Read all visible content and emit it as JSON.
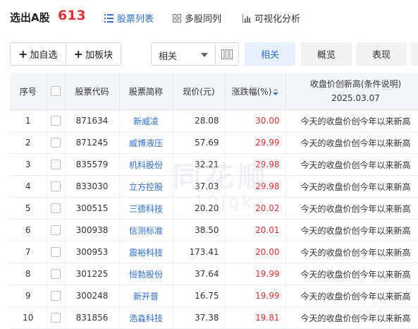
{
  "header": {
    "title": "选出A股",
    "count": "613",
    "tabs": [
      {
        "label": "股票列表",
        "icon": "list-icon"
      },
      {
        "label": "多股同列",
        "icon": "grid-icon"
      },
      {
        "label": "可视化分析",
        "icon": "bar-chart-icon"
      }
    ]
  },
  "toolbar": {
    "add_watch": "加自选",
    "add_sector": "加板块",
    "select_value": "相关",
    "segments": [
      "相关",
      "概览",
      "表现"
    ]
  },
  "table": {
    "columns": [
      "序号",
      "",
      "股票代码",
      "股票简称",
      "现价(元)",
      "涨跌幅(%)",
      "收盘价创新高(条件说明)"
    ],
    "condition_date": "2025.03.07",
    "rows": [
      {
        "idx": "1",
        "code": "871634",
        "name": "新威凌",
        "price": "28.08",
        "chg": "30.00",
        "cond": "今天的收盘价创今年以来新高"
      },
      {
        "idx": "2",
        "code": "871245",
        "name": "威博液压",
        "price": "57.69",
        "chg": "29.99",
        "cond": "今天的收盘价创今年以来新高"
      },
      {
        "idx": "3",
        "code": "835579",
        "name": "机科股份",
        "price": "32.21",
        "chg": "29.98",
        "cond": "今天的收盘价创今年以来新高"
      },
      {
        "idx": "4",
        "code": "833030",
        "name": "立方控股",
        "price": "37.03",
        "chg": "29.98",
        "cond": "今天的收盘价创今年以来新高"
      },
      {
        "idx": "5",
        "code": "300515",
        "name": "三德科技",
        "price": "20.20",
        "chg": "20.02",
        "cond": "今天的收盘价创今年以来新高"
      },
      {
        "idx": "6",
        "code": "300938",
        "name": "信测标准",
        "price": "38.50",
        "chg": "20.01",
        "cond": "今天的收盘价创今年以来新高"
      },
      {
        "idx": "7",
        "code": "300953",
        "name": "震裕科技",
        "price": "173.41",
        "chg": "20.00",
        "cond": "今天的收盘价创今年以来新高"
      },
      {
        "idx": "8",
        "code": "301225",
        "name": "恒勃股份",
        "price": "37.64",
        "chg": "19.99",
        "cond": "今天的收盘价创今年以来新高"
      },
      {
        "idx": "9",
        "code": "300248",
        "name": "新开普",
        "price": "16.75",
        "chg": "19.99",
        "cond": "今天的收盘价创今年以来新高"
      },
      {
        "idx": "10",
        "code": "831856",
        "name": "浩淼科技",
        "price": "37.38",
        "chg": "19.81",
        "cond": "今天的收盘价创今年以来新高"
      }
    ]
  },
  "watermark": {
    "text": "同花顺",
    "text2": "10jqka"
  },
  "colors": {
    "accent": "#2e6fdc",
    "up": "#e93030",
    "count": "#e93030"
  }
}
